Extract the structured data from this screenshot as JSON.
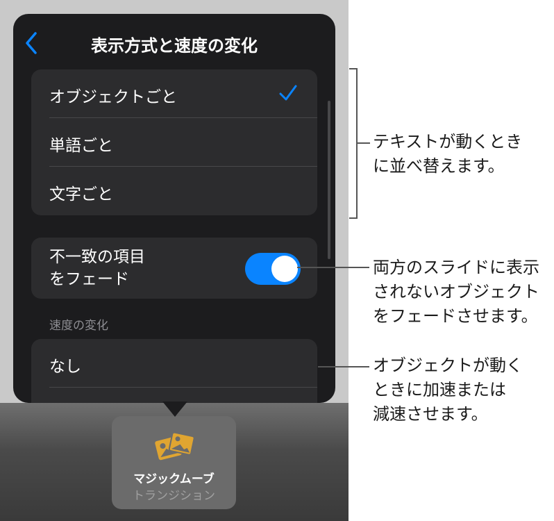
{
  "nav": {
    "title": "表示方式と速度の変化",
    "back_icon": "chevron-left-icon"
  },
  "delivery_options": [
    {
      "label": "オブジェクトごと",
      "selected": true
    },
    {
      "label": "単語ごと",
      "selected": false
    },
    {
      "label": "文字ごと",
      "selected": false
    }
  ],
  "fade": {
    "label_line1": "不一致の項目",
    "label_line2": "をフェード",
    "on": true
  },
  "speed": {
    "header": "速度の変化",
    "options": [
      "なし"
    ]
  },
  "transition_tile": {
    "name": "マジックムーブ",
    "category": "トランジション",
    "icon": "photos-icon"
  },
  "callouts": {
    "delivery": [
      "テキストが動くとき",
      "に並べ替えます。"
    ],
    "fade": [
      "両方のスライドに表示",
      "されないオブジェクト",
      "をフェードさせます。"
    ],
    "speed": [
      "オブジェクトが動く",
      "ときに加速または",
      "減速させます。"
    ]
  },
  "colors": {
    "accent": "#0a84ff",
    "tile_icon": "#e0a531"
  }
}
